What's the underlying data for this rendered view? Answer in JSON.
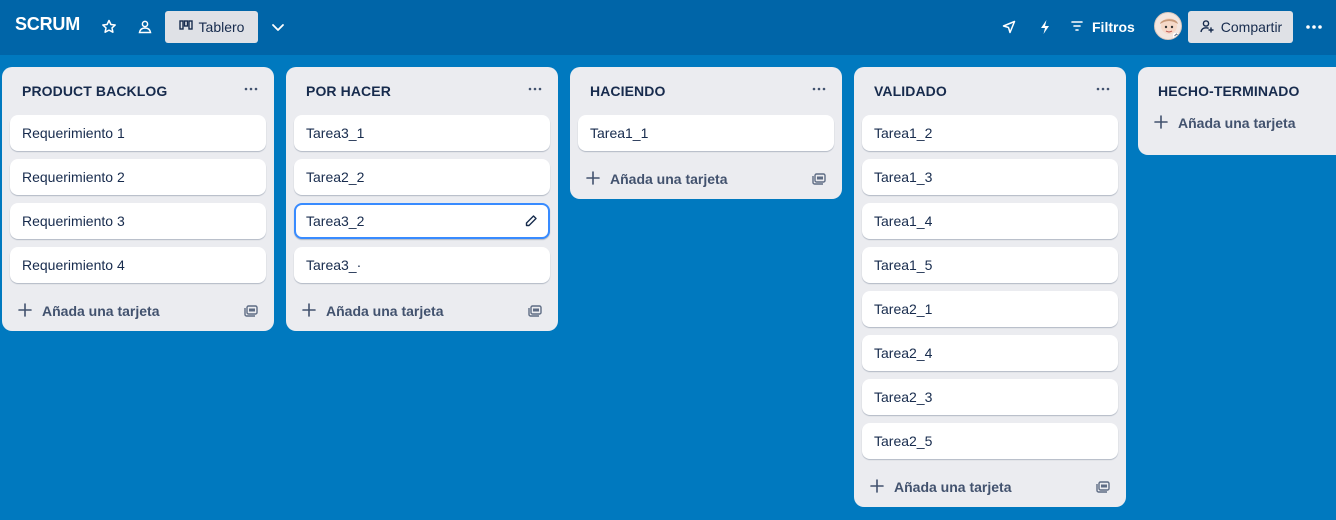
{
  "header": {
    "board_title": "SCRUM",
    "view_label": "Tablero",
    "filters_label": "Filtros",
    "share_label": "Compartir",
    "icons": [
      "star-icon",
      "workspace-icon",
      "board-view-icon",
      "chevron-down-icon",
      "rocket-icon",
      "lightning-icon",
      "filter-icon",
      "add-user-icon",
      "more-icon"
    ]
  },
  "lists": [
    {
      "title": "PRODUCT BACKLOG",
      "cards": [
        "Requerimiento 1",
        "Requerimiento 2",
        "Requerimiento 3",
        "Requerimiento 4"
      ],
      "add_label": "Añada una tarjeta"
    },
    {
      "title": "POR HACER",
      "cards": [
        "Tarea3_1",
        "Tarea2_2",
        "Tarea3_2",
        "Tarea3_·"
      ],
      "add_label": "Añada una tarjeta"
    },
    {
      "title": "HACIENDO",
      "cards": [
        "Tarea1_1"
      ],
      "add_label": "Añada una tarjeta"
    },
    {
      "title": "VALIDADO",
      "cards": [
        "Tarea1_2",
        "Tarea1_3",
        "Tarea1_4",
        "Tarea1_5",
        "Tarea2_1",
        "Tarea2_4",
        "Tarea2_3",
        "Tarea2_5"
      ],
      "add_label": "Añada una tarjeta"
    },
    {
      "title": "HECHO-TERMINADO",
      "cards": [],
      "add_label": "Añada una tarjeta"
    }
  ],
  "colors": {
    "board_background": "#0079bf",
    "header_background": "#0065a8",
    "list_background": "#ebecf0",
    "selected_card_border": "#388bff"
  }
}
